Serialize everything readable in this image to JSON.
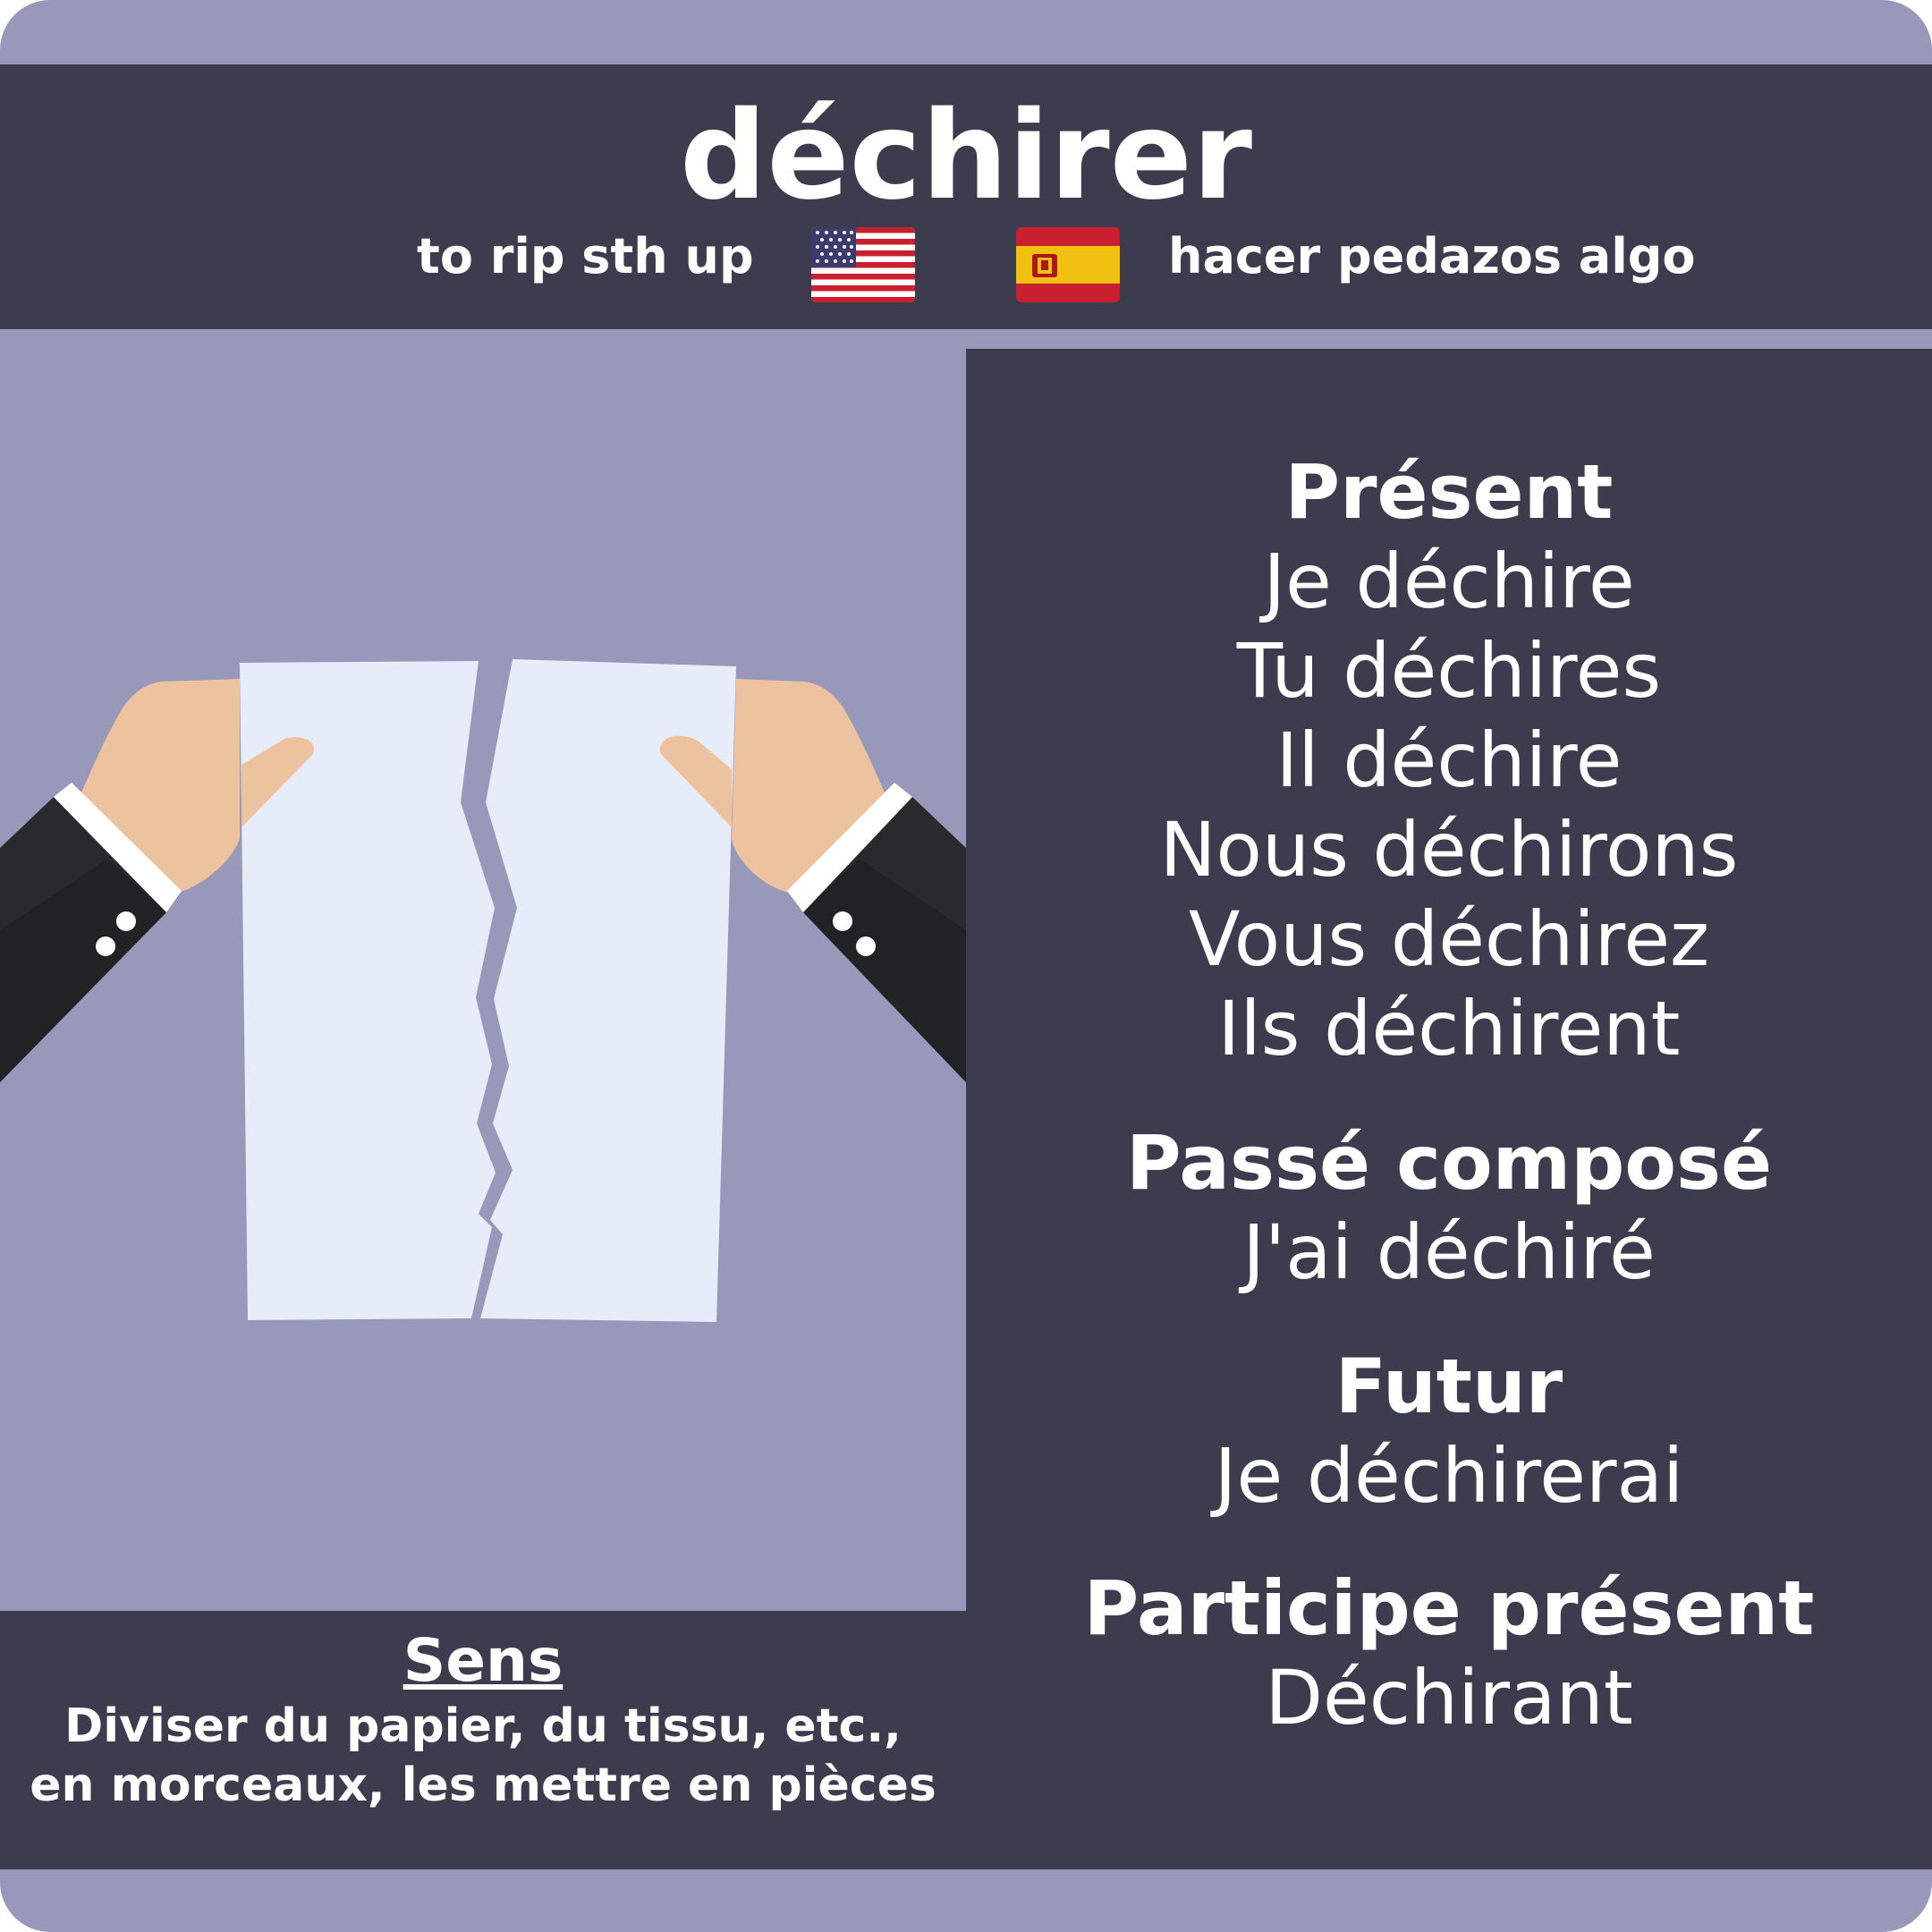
{
  "verb": "déchirer",
  "translations": {
    "english": "to rip sth up",
    "english_flag": "us-flag-icon",
    "spanish": "hacer pedazos algo",
    "spanish_flag": "spain-flag-icon"
  },
  "tenses": {
    "present": {
      "name": "Présent",
      "forms": [
        "Je déchire",
        "Tu déchires",
        "Il déchire",
        "Nous déchirons",
        "Vous déchirez",
        "Ils déchirent"
      ]
    },
    "passe_compose": {
      "name": "Passé composé",
      "form": "J'ai déchiré"
    },
    "futur": {
      "name": "Futur",
      "form": "Je déchirerai"
    },
    "participe_present": {
      "name": "Participe présent",
      "form": "Déchirant"
    }
  },
  "meaning": {
    "title": "Sens",
    "text": "Diviser du papier, du tissu, etc., en morceaux, les mettre en pièces"
  },
  "illustration": "hands-tearing-paper",
  "colors": {
    "background": "#9898bb",
    "panel": "#3d3c4e",
    "text": "#ffffff",
    "paper": "#e6ecf8",
    "skin": "#edc29e",
    "sleeve": "#2a2a2c"
  }
}
